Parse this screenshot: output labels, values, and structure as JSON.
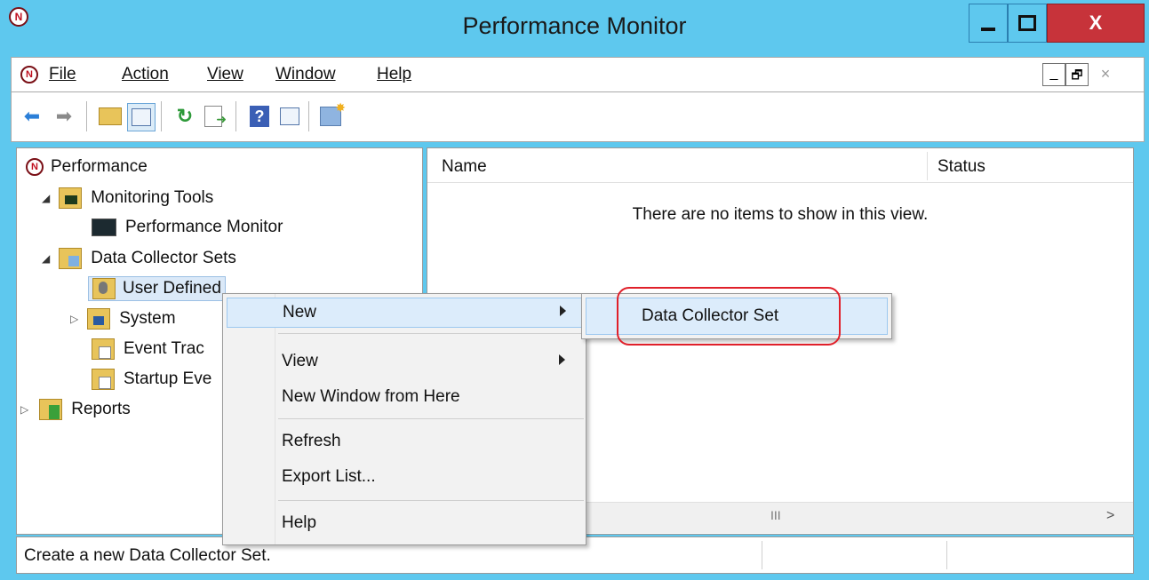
{
  "window": {
    "title": "Performance Monitor",
    "min_label": "_",
    "max_label": "☐",
    "close_label": "X"
  },
  "menubar": {
    "items": [
      "File",
      "Action",
      "View",
      "Window",
      "Help"
    ],
    "mdi_min": "_",
    "mdi_restore": "🗗",
    "mdi_close": "×"
  },
  "toolbar": {
    "icons": [
      "back-arrow-icon",
      "forward-arrow-icon",
      "up-folder-icon",
      "show-hide-console-tree-icon",
      "refresh-icon",
      "export-list-icon",
      "help-icon",
      "show-action-pane-icon",
      "new-data-collector-set-icon"
    ]
  },
  "tree": {
    "root": "Performance",
    "monitoring_tools": "Monitoring Tools",
    "performance_monitor": "Performance Monitor",
    "data_collector_sets": "Data Collector Sets",
    "user_defined": "User Defined",
    "system": "System",
    "event_trace": "Event Trac",
    "startup_event": "Startup Eve",
    "reports": "Reports"
  },
  "list": {
    "columns": [
      "Name",
      "Status"
    ],
    "empty_message": "There are no items to show in this view.",
    "scroll_thumb": "III",
    "scroll_right": ">"
  },
  "context_menu": {
    "new": "New",
    "view": "View",
    "new_window": "New Window from Here",
    "refresh": "Refresh",
    "export_list": "Export List...",
    "help": "Help"
  },
  "submenu": {
    "data_collector_set": "Data Collector Set"
  },
  "highlight_color": "#e0202a",
  "status": {
    "text": "Create a new Data Collector Set."
  }
}
